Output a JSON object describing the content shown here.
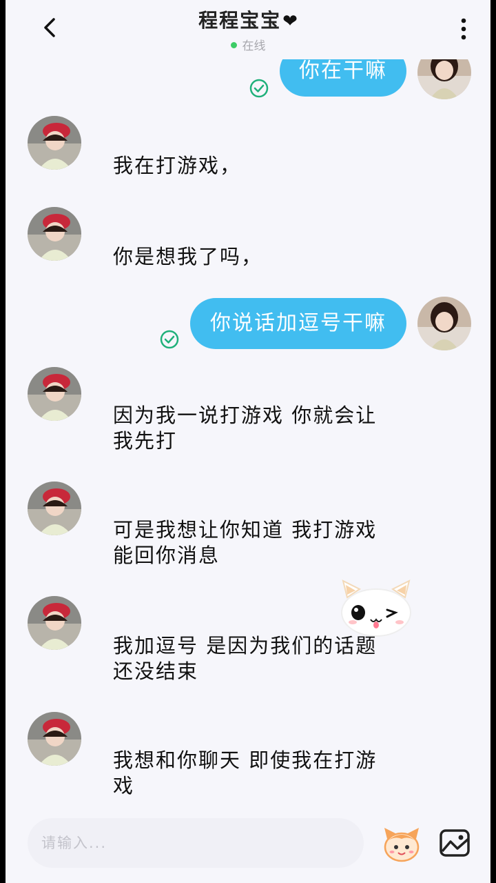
{
  "header": {
    "title": "程程宝宝",
    "heart": "❤",
    "status": "在线",
    "status_color": "#3ccc66"
  },
  "colors": {
    "bubble_out": "#41bdf0",
    "check": "#1fb07a",
    "background": "#f6f6fb"
  },
  "messages": [
    {
      "side": "out",
      "text": "你在干嘛",
      "read": true
    },
    {
      "side": "in",
      "text": "我在打游戏，"
    },
    {
      "side": "in",
      "text": "你是想我了吗，"
    },
    {
      "side": "out",
      "text": "你说话加逗号干嘛",
      "read": true
    },
    {
      "side": "in",
      "line1": "因为我一说打游戏 你就会让",
      "line2": "我先打"
    },
    {
      "side": "in",
      "line1": "可是我想让你知道 我打游戏",
      "line2": "能回你消息"
    },
    {
      "side": "in",
      "line1": "我加逗号 是因为我们的话题",
      "line2": "还没结束"
    },
    {
      "side": "in",
      "line1": "我想和你聊天 即使我在打游",
      "line2": "戏"
    }
  ],
  "input": {
    "placeholder": "请输入..."
  },
  "icons": [
    "back-arrow-icon",
    "more-vertical-icon",
    "read-check-icon",
    "cat-sticker",
    "emoji-face-icon",
    "image-icon"
  ]
}
